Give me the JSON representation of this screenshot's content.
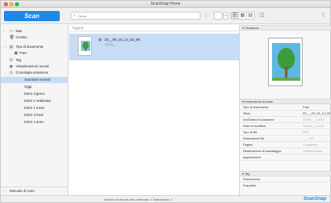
{
  "window": {
    "title": "ScanSnap Home"
  },
  "toolbar": {
    "scan_label": "Scan",
    "search_placeholder": "Cerca",
    "icons": [
      "star-icon",
      "list-view-icon",
      "grid-view-icon",
      "large-grid-icon",
      "panel-toggle-icon",
      "share-icon"
    ]
  },
  "sidebar": {
    "items": [
      {
        "label": "Mac",
        "icon": "computer-icon",
        "chevron": ">"
      },
      {
        "label": "Cestino",
        "icon": "trash-icon",
        "chevron": ""
      },
      {
        "label": "Tipo di documento",
        "icon": "document-icon",
        "chevron": "v"
      },
      {
        "label": "Foto",
        "icon": "photo-icon",
        "chevron": ""
      },
      {
        "label": "Tag",
        "icon": "tag-icon",
        "chevron": ""
      },
      {
        "label": "Visualizzazioni recenti",
        "icon": "eye-icon",
        "chevron": ""
      },
      {
        "label": "Cronologia scansione",
        "icon": "clock-icon",
        "chevron": "v"
      },
      {
        "label": "Scansioni recenti",
        "selected": true
      },
      {
        "label": "Oggi"
      },
      {
        "label": "Entro 3 giorni"
      },
      {
        "label": "Entro 1 settimana"
      },
      {
        "label": "Entro 1 mese"
      },
      {
        "label": "Entro 3 mesi"
      },
      {
        "label": "Entro 1 anno"
      }
    ],
    "footer": "Manuale di Aiuto"
  },
  "main": {
    "header": "Oggetti",
    "items": [
      {
        "name": "20__09_10_14_53_59",
        "date": "10/09/__"
      }
    ]
  },
  "panel": {
    "preview_section": "Visualizza",
    "info_section": "Informazioni di base",
    "rows": [
      {
        "k": "Tipo di documento",
        "v": "Foto",
        "dim": false
      },
      {
        "k": "Titolo",
        "v": "20___09_10_14_53_59",
        "dim": false
      },
      {
        "k": "Ora/Data di scansione",
        "v": "10/09/__ 14:53",
        "dim": true
      },
      {
        "k": "Data di modifica",
        "v": "10/09/__ 14:53",
        "dim": true
      },
      {
        "k": "Tipo di file",
        "v": "PDF",
        "dim": true
      },
      {
        "k": "Dimensione file",
        "v": "___ KB",
        "dim": true
      },
      {
        "k": "Pagine",
        "v": "1 pagina/e",
        "dim": true
      },
      {
        "k": "Destinazione di salvataggio",
        "v": "Cartella locale",
        "dim": true
      },
      {
        "k": "Applicazione",
        "v": "",
        "dim": true
      }
    ],
    "tag_section": "Tag",
    "rows2": [
      {
        "k": "Promemoria",
        "v": ""
      },
      {
        "k": "Proprietà",
        "v": ""
      }
    ]
  },
  "status": {
    "text": "Numero di record dell contenuto: 1   Selezionato: 1",
    "brand": "ScanSnap"
  },
  "colors": {
    "accent": "#1e88e5",
    "selection": "#c7dcf5"
  }
}
